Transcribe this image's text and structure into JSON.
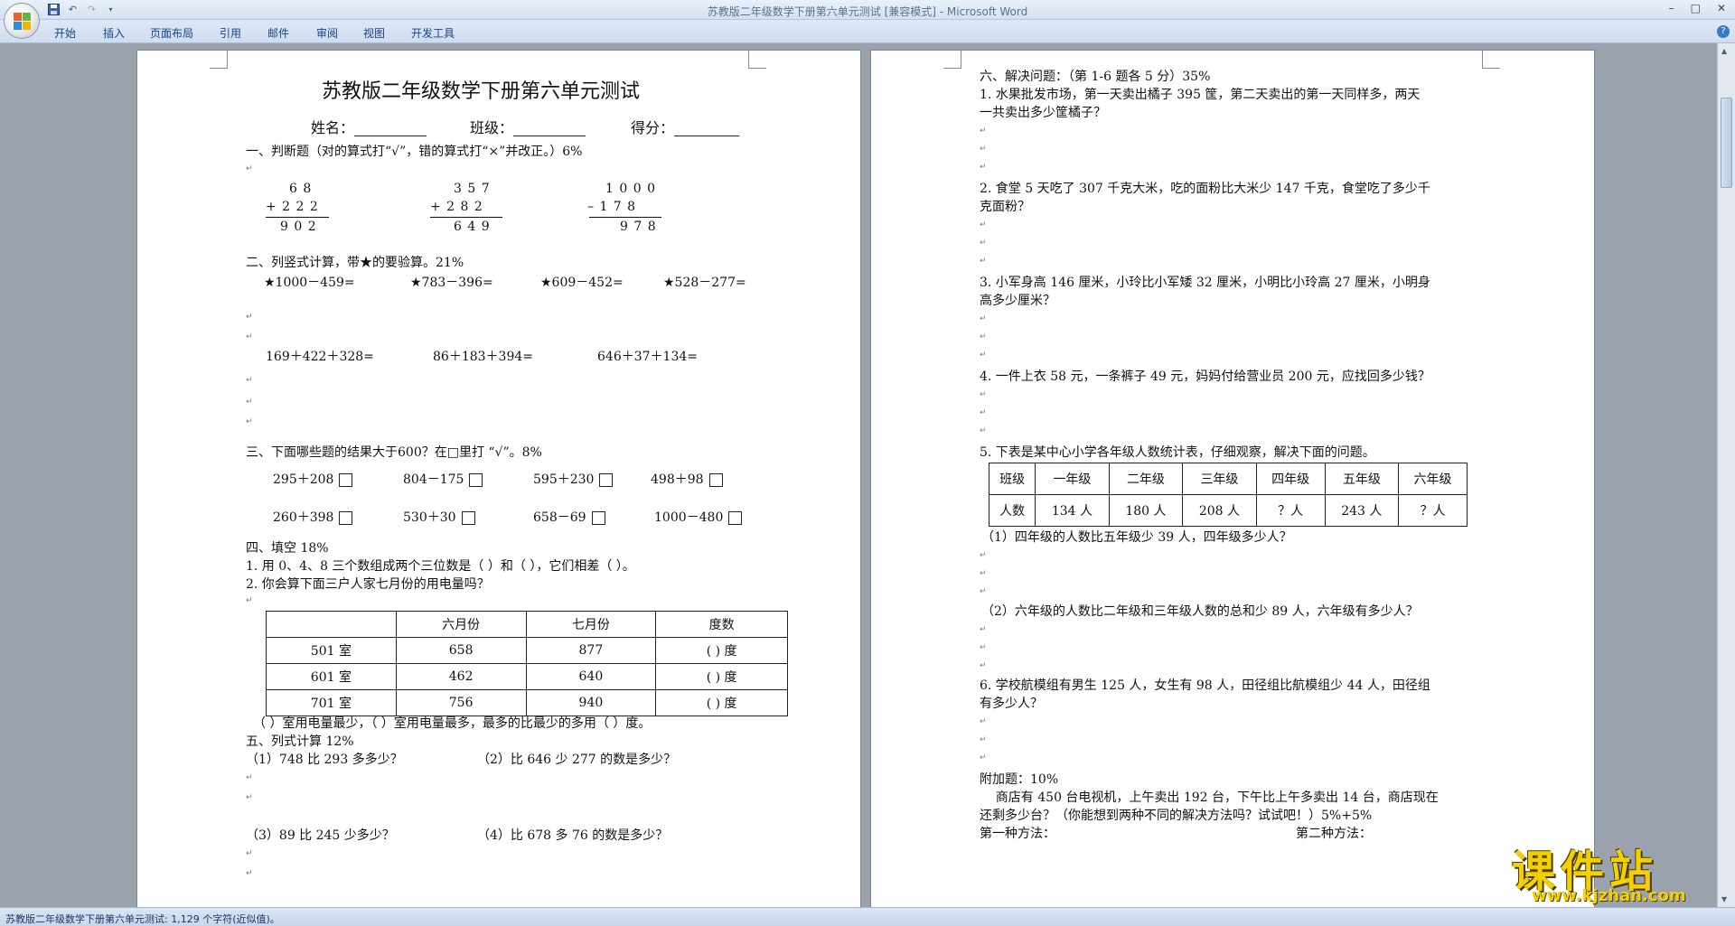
{
  "window": {
    "title": "苏教版二年级数学下册第六单元测试 [兼容模式] - Microsoft Word"
  },
  "ribbon_tabs": [
    "开始",
    "插入",
    "页面布局",
    "引用",
    "邮件",
    "审阅",
    "视图",
    "开发工具"
  ],
  "status_bar": {
    "text": "苏教版二年级数学下册第六单元测试: 1,129 个字符(近似值)。"
  },
  "watermark": {
    "main": "课件站",
    "url": "www.kjzhan.com"
  },
  "page1": {
    "title": "苏教版二年级数学下册第六单元测试",
    "name_label": "姓名：",
    "class_label": "班级：",
    "score_label": "得分：",
    "s1_heading": "一、判断题（对的算式打“√”，错的算式打“×”并改正。）6%",
    "calc1": {
      "top": "6 8",
      "op": "+ 2 2 2",
      "result": "9 0 2"
    },
    "calc2": {
      "top": "3 5 7",
      "op": "+ 2 8 2",
      "result": "6 4 9"
    },
    "calc3": {
      "top": "1 0 0 0",
      "op": "–  1 7 8",
      "result": "9 7 8"
    },
    "s2_heading": "二、列竖式计算，带★的要验算。21%",
    "s2_row1": [
      "★1000－459=",
      "★783－396=",
      "★609－452=",
      "★528－277="
    ],
    "s2_row2": [
      "169＋422＋328=",
      "86＋183＋394=",
      "646＋37＋134="
    ],
    "s3_heading": "三、下面哪些题的结果大于600？在□里打 “√”。8%",
    "s3_row1": [
      "295＋208",
      "804－175",
      "595＋230",
      "498＋98"
    ],
    "s3_row2": [
      "260＋398",
      "530＋30",
      "658－69",
      "1000－480"
    ],
    "s4_heading": "四、填空 18%",
    "s4_q1": "1. 用 0、4、8 三个数组成两个三位数是（      ）和（      ），它们相差（      ）。",
    "s4_q2": "2. 你会算下面三户人家七月份的用电量吗？",
    "table_headers": [
      "",
      "六月份",
      "七月份",
      "度数"
    ],
    "table_rows": [
      [
        "501 室",
        "658",
        "877",
        "(      ) 度"
      ],
      [
        "601 室",
        "462",
        "640",
        "(      ) 度"
      ],
      [
        "701 室",
        "756",
        "940",
        "(      ) 度"
      ]
    ],
    "s4_after": "（      ）室用电量最少，（      ）室用电量最多，最多的比最少的多用（      ）度。",
    "s5_heading": "五、列式计算 12%",
    "s5_q1": "（1）748 比 293 多多少？",
    "s5_q2": "（2）比 646 少 277 的数是多少？",
    "s5_q3": "（3）89 比 245 少多少？",
    "s5_q4": "（4）比 678 多 76 的数是多少？"
  },
  "page2": {
    "heading": "六、解决问题：（第 1-6 题各 5 分）35%",
    "q1_l1": "1. 水果批发市场，第一天卖出橘子 395 筐，第二天卖出的第一天同样多，两天",
    "q1_l2": "一共卖出多少筐橘子？",
    "q2_l1": "2. 食堂 5 天吃了 307 千克大米，吃的面粉比大米少 147 千克，食堂吃了多少千",
    "q2_l2": "克面粉？",
    "q3_l1": "3. 小军身高 146 厘米，小玲比小军矮 32 厘米，小明比小玲高 27 厘米，小明身",
    "q3_l2": "高多少厘米？",
    "q4": "4. 一件上衣 58 元，一条裤子 49 元，妈妈付给营业员 200 元，应找回多少钱？",
    "q5": "5. 下表是某中心小学各年级人数统计表，仔细观察，解决下面的问题。",
    "grade_headers": [
      "班级",
      "一年级",
      "二年级",
      "三年级",
      "四年级",
      "五年级",
      "六年级"
    ],
    "grade_values": [
      "人数",
      "134 人",
      "180 人",
      "208 人",
      "？人",
      "243 人",
      "？人"
    ],
    "q5_sub1": "（1）四年级的人数比五年级少 39 人，四年级多少人？",
    "q5_sub2": "（2）六年级的人数比二年级和三年级人数的总和少 89 人，六年级有多少人？",
    "q6_l1": "6. 学校航模组有男生 125 人，女生有 98 人，田径组比航模组少 44 人，田径组",
    "q6_l2": "有多少人？",
    "bonus_heading": "附加题：10%",
    "bonus_l1": "    商店有 450 台电视机，上午卖出 192 台，下午比上午多卖出 14 台，商店现在",
    "bonus_l2": "还剩多少台？（你能想到两种不同的解决方法吗？试试吧！）5%+5%",
    "method1": "第一种方法：",
    "method2": "第二种方法："
  }
}
